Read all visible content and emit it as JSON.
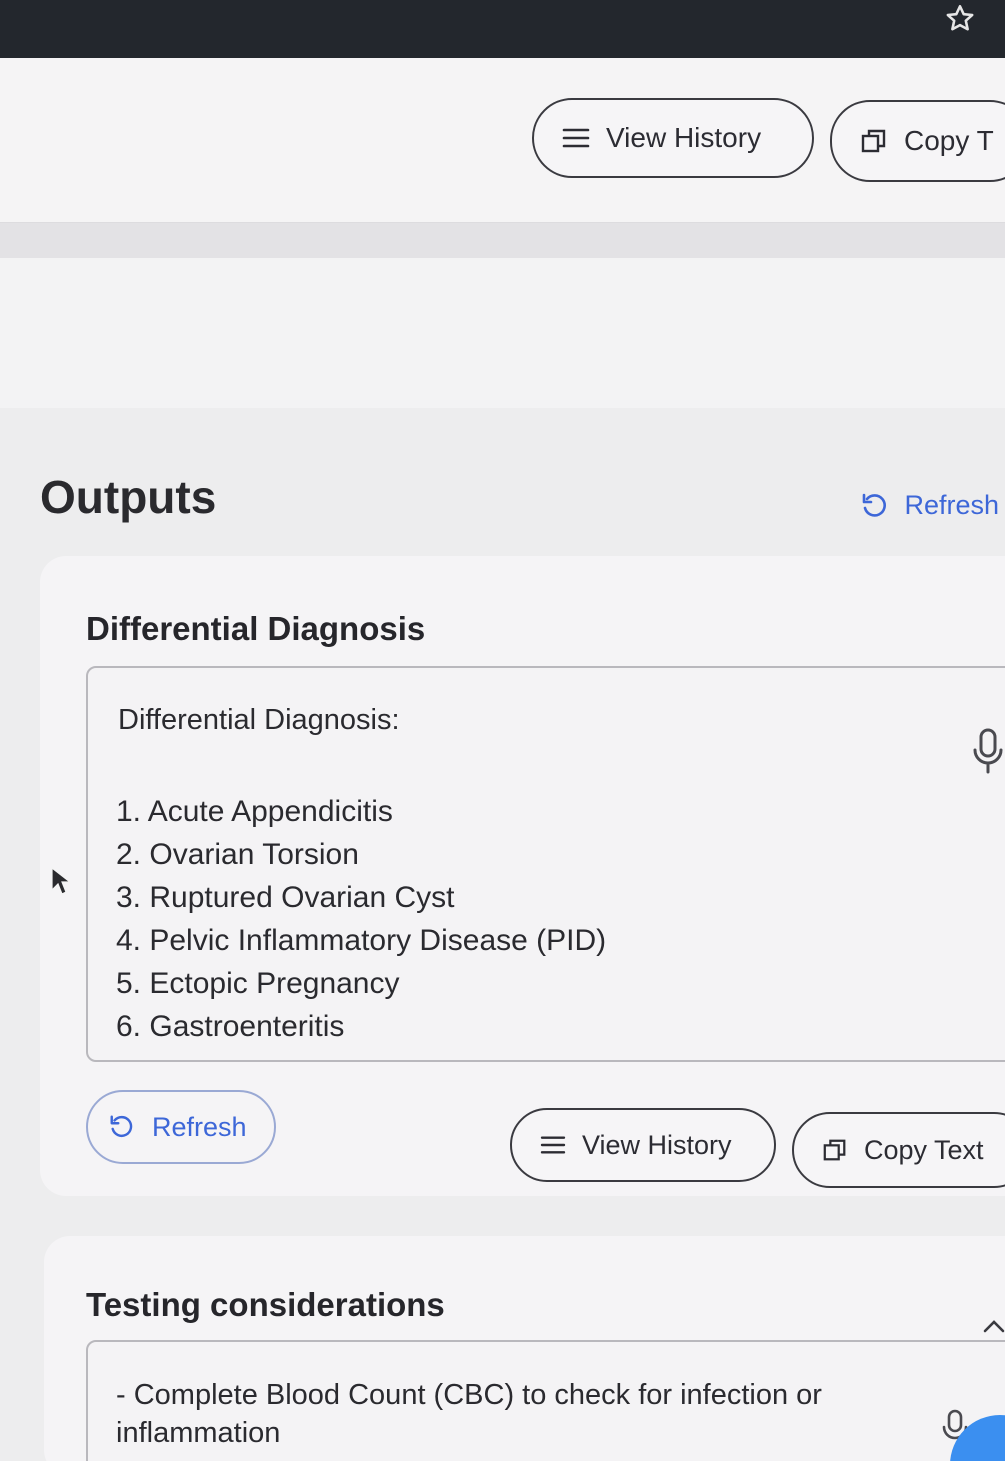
{
  "top_toolbar": {
    "view_history_label": "View History",
    "copy_label": "Copy T"
  },
  "outputs": {
    "title": "Outputs",
    "refresh_label": "Refresh"
  },
  "differential_card": {
    "title": "Differential Diagnosis",
    "text_heading": "Differential Diagnosis:",
    "items": [
      "1. Acute Appendicitis",
      "2. Ovarian Torsion",
      "3. Ruptured Ovarian Cyst",
      "4. Pelvic Inflammatory Disease (PID)",
      "5. Ectopic Pregnancy",
      "6. Gastroenteritis"
    ],
    "refresh_label": "Refresh",
    "view_history_label": "View History",
    "copy_label": "Copy Text"
  },
  "testing_card": {
    "title": "Testing considerations",
    "text": "- Complete Blood Count (CBC) to check for infection or inflammation"
  },
  "colors": {
    "accent": "#3d67d8",
    "browser_bar": "#23272d",
    "fab": "#3b8ff0"
  }
}
